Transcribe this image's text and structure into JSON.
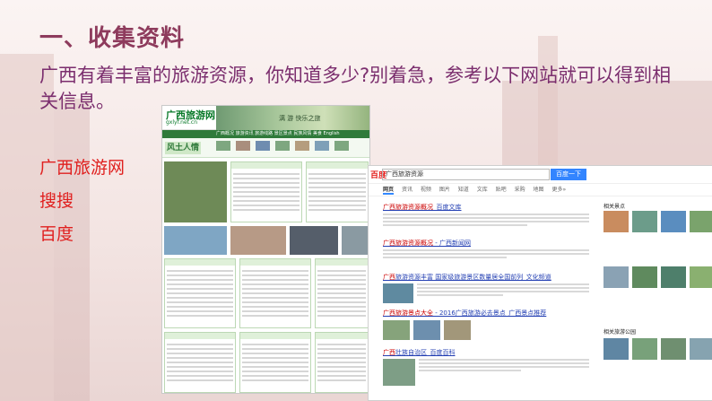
{
  "slide": {
    "title": "一、收集资料",
    "intro": "广西有着丰富的旅游资源，你知道多少?别着急，参考以下网站就可以得到相关信息。",
    "links": [
      "广西旅游网",
      "搜搜",
      "百度"
    ]
  },
  "shot1": {
    "logo": "广西旅游网",
    "url": "gxlyf.net.cn",
    "banner_text": "漓 游          快乐之旅",
    "nav": "广西概况  旅游资讯  旅游线路  景区景点  民族风情  美食  English",
    "strip_label": "风土人情"
  },
  "shot2": {
    "logo": "百度",
    "query": "广西旅游资源",
    "search_button": "百度一下",
    "tabs": [
      "网页",
      "资讯",
      "视频",
      "图片",
      "知道",
      "文库",
      "贴吧",
      "采购",
      "地图",
      "更多»"
    ],
    "results": [
      {
        "title_red": "广西旅游资源概况",
        "title": "_百度文库"
      },
      {
        "title_red": "广西旅游资源概况",
        "title": " - 广西新闻网"
      },
      {
        "title_red": "广西",
        "title": "旅游资源丰富 国家级旅游景区数量居全国前列_文化频道"
      },
      {
        "title_red": "广西旅游景点大全",
        "title": " - 2016广西旅游必去景点_广西景点推荐"
      },
      {
        "title_red": "广西",
        "title": "壮族自治区_百度百科"
      }
    ],
    "side_title": "相关景点",
    "side_title2": "相关旅游公园"
  }
}
